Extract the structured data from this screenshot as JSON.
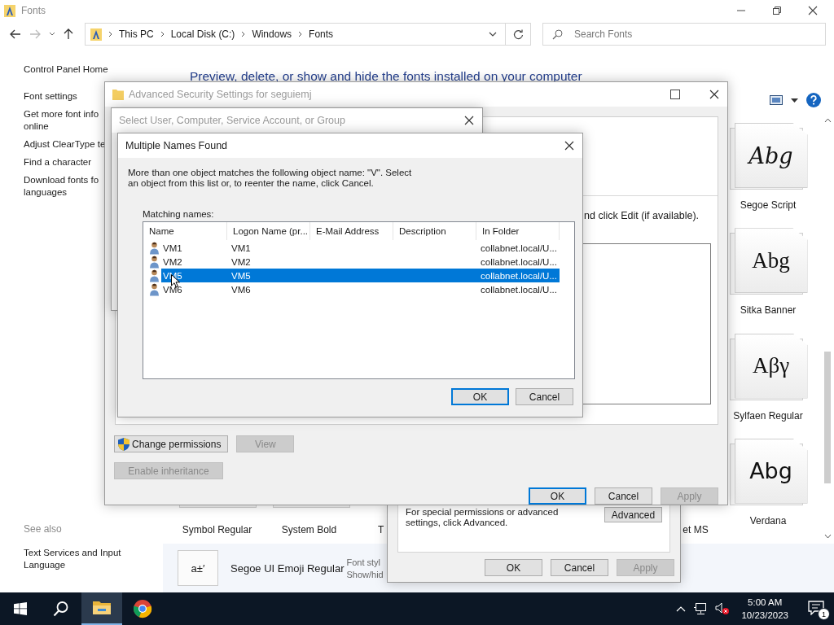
{
  "explorer": {
    "title": "Fonts",
    "breadcrumb": [
      "This PC",
      "Local Disk (C:)",
      "Windows",
      "Fonts"
    ],
    "search": {
      "placeholder": "Search Fonts"
    },
    "sidebar": {
      "items": [
        {
          "lines": [
            "Control Panel Home"
          ]
        },
        {
          "lines": [
            "Font settings"
          ]
        },
        {
          "lines": [
            "Get more font info",
            "online"
          ]
        },
        {
          "lines": [
            "Adjust ClearType te"
          ]
        },
        {
          "lines": [
            "Find a character"
          ]
        },
        {
          "lines": [
            "Download fonts fo",
            "languages"
          ]
        }
      ],
      "see_also": {
        "heading": "See also",
        "items": [
          {
            "lines": [
              "Text Services and Input",
              "Language"
            ]
          }
        ]
      }
    },
    "heading": "Preview, delete, or show and hide the fonts installed on your computer",
    "font_column": [
      {
        "name": "Segoe Script",
        "preview": "Abg",
        "kind": "script"
      },
      {
        "name": "Sitka Banner",
        "preview": "Abg",
        "kind": "serif"
      },
      {
        "name": "Sylfaen Regular",
        "preview": "Aβγ",
        "kind": "serif"
      },
      {
        "name": "Verdana",
        "preview": "Abg",
        "kind": "sans"
      }
    ],
    "font_row": [
      {
        "name": "Symbol Regular"
      },
      {
        "name": "System Bold"
      },
      {
        "name": "T"
      },
      {
        "name": "et MS"
      }
    ],
    "details": {
      "preview": "a±′",
      "name": "Segoe UI Emoji Regular",
      "lines": [
        "Font styl",
        "Show/hid"
      ]
    }
  },
  "properties": {
    "text": "For special permissions or advanced settings, click Advanced.",
    "advanced": "Advanced",
    "buttons": [
      {
        "label": "OK",
        "disabled": false
      },
      {
        "label": "Cancel",
        "disabled": false
      },
      {
        "label": "Apply",
        "disabled": true
      }
    ]
  },
  "advanced_security": {
    "title": "Advanced Security Settings for seguiemj",
    "hint": "nd click Edit (if available).",
    "actions": [
      {
        "label": "Change permissions",
        "disabled": false
      },
      {
        "label": "View",
        "disabled": true
      },
      {
        "label": "Enable inheritance",
        "disabled": true
      }
    ],
    "buttons": [
      {
        "label": "OK",
        "disabled": false,
        "default": true
      },
      {
        "label": "Cancel",
        "disabled": false,
        "default": false
      },
      {
        "label": "Apply",
        "disabled": true,
        "default": false
      }
    ]
  },
  "select_dialog": {
    "title": "Select User, Computer, Service Account, or Group"
  },
  "multiple_names": {
    "title": "Multiple Names Found",
    "message": "More than one object matches the following object name: \"V\". Select an object from this list or, to reenter the name, click Cancel.",
    "list_label": "Matching names:",
    "columns": [
      "Name",
      "Logon Name (pr...",
      "E-Mail Address",
      "Description",
      "In Folder"
    ],
    "rows": [
      {
        "cells": [
          "VM1",
          "VM1",
          "",
          "",
          "collabnet.local/U..."
        ],
        "selected": false
      },
      {
        "cells": [
          "VM2",
          "VM2",
          "",
          "",
          "collabnet.local/U..."
        ],
        "selected": false
      },
      {
        "cells": [
          "VM5",
          "VM5",
          "",
          "",
          "collabnet.local/U..."
        ],
        "selected": true
      },
      {
        "cells": [
          "VM6",
          "VM6",
          "",
          "",
          "collabnet.local/U..."
        ],
        "selected": false
      }
    ],
    "buttons": [
      {
        "label": "OK",
        "default": true
      },
      {
        "label": "Cancel",
        "default": false
      }
    ]
  },
  "taskbar": {
    "apps": [
      {
        "kind": "start",
        "active": false
      },
      {
        "kind": "search",
        "active": false
      },
      {
        "kind": "explorer",
        "active": true
      },
      {
        "kind": "browser",
        "active": false
      }
    ],
    "time": "5:00 AM",
    "date": "10/23/2023",
    "notifications": "1"
  }
}
